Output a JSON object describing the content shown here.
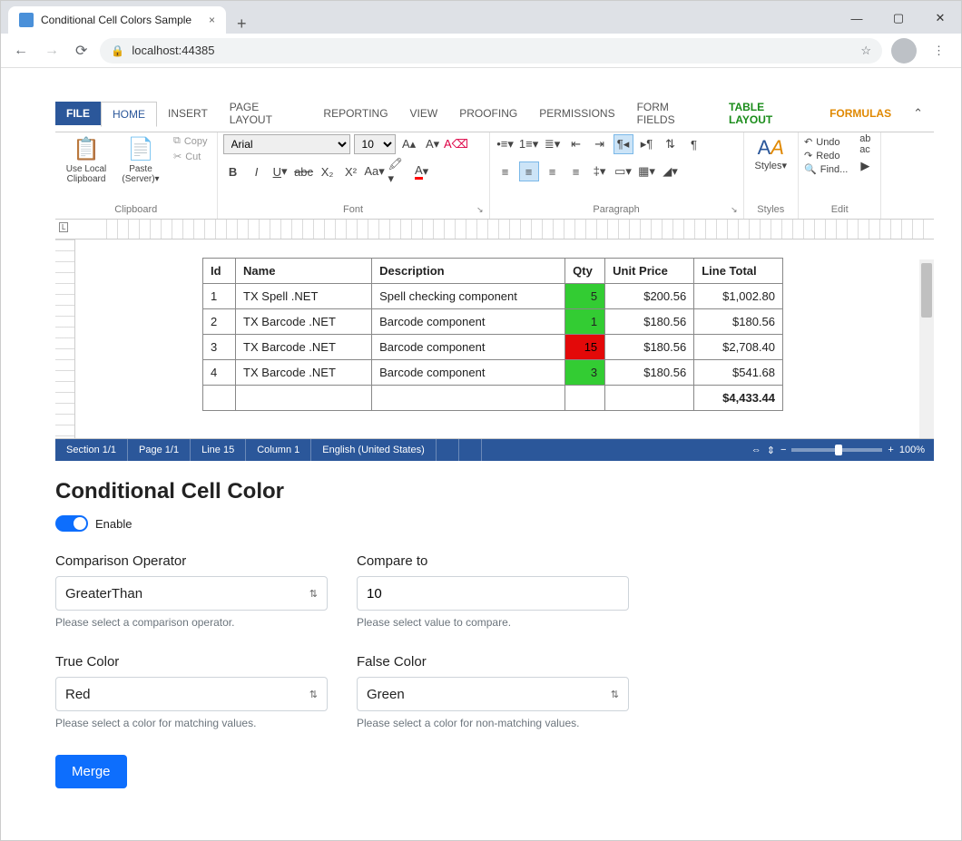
{
  "browser": {
    "tab_title": "Conditional Cell Colors Sample",
    "url": "localhost:44385"
  },
  "ribbon": {
    "tabs": [
      "FILE",
      "HOME",
      "INSERT",
      "PAGE LAYOUT",
      "REPORTING",
      "VIEW",
      "PROOFING",
      "PERMISSIONS",
      "FORM FIELDS",
      "TABLE LAYOUT",
      "FORMULAS"
    ],
    "clipboard": {
      "use_local": "Use Local\nClipboard",
      "paste": "Paste\n(Server)▾",
      "copy": "Copy",
      "cut": "Cut",
      "label": "Clipboard"
    },
    "font": {
      "name": "Arial",
      "size": "10",
      "label": "Font"
    },
    "paragraph": {
      "label": "Paragraph"
    },
    "styles": {
      "label": "Styles",
      "btn": "Styles▾"
    },
    "editing": {
      "undo": "Undo",
      "redo": "Redo",
      "find": "Find...",
      "label": "Edit"
    }
  },
  "table": {
    "headers": [
      "Id",
      "Name",
      "Description",
      "Qty",
      "Unit Price",
      "Line Total"
    ],
    "rows": [
      {
        "id": "1",
        "name": "TX Spell .NET",
        "desc": "Spell checking component",
        "qty": "5",
        "qty_color": "green",
        "unit": "$200.56",
        "total": "$1,002.80"
      },
      {
        "id": "2",
        "name": "TX Barcode .NET",
        "desc": "Barcode component",
        "qty": "1",
        "qty_color": "green",
        "unit": "$180.56",
        "total": "$180.56"
      },
      {
        "id": "3",
        "name": "TX Barcode .NET",
        "desc": "Barcode component",
        "qty": "15",
        "qty_color": "red",
        "unit": "$180.56",
        "total": "$2,708.40"
      },
      {
        "id": "4",
        "name": "TX Barcode .NET",
        "desc": "Barcode component",
        "qty": "3",
        "qty_color": "green",
        "unit": "$180.56",
        "total": "$541.68"
      }
    ],
    "grand_total": "$4,433.44"
  },
  "statusbar": {
    "section": "Section 1/1",
    "page": "Page 1/1",
    "line": "Line 15",
    "column": "Column 1",
    "lang": "English (United States)",
    "zoom": "100%"
  },
  "form": {
    "heading": "Conditional Cell Color",
    "enable_label": "Enable",
    "comparison": {
      "label": "Comparison Operator",
      "value": "GreaterThan",
      "help": "Please select a comparison operator."
    },
    "compare_to": {
      "label": "Compare to",
      "value": "10",
      "help": "Please select value to compare."
    },
    "true_color": {
      "label": "True Color",
      "value": "Red",
      "help": "Please select a color for matching values."
    },
    "false_color": {
      "label": "False Color",
      "value": "Green",
      "help": "Please select a color for non-matching values."
    },
    "merge_btn": "Merge"
  }
}
